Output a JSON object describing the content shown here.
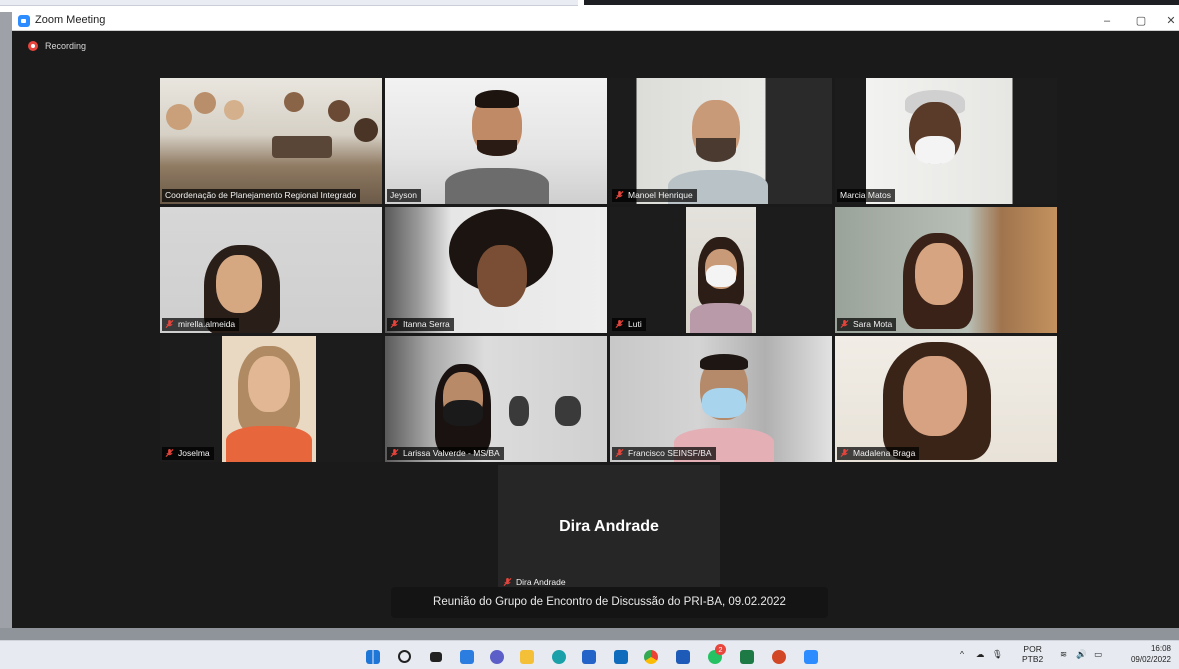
{
  "window": {
    "title": "Zoom Meeting",
    "minimize": "–",
    "maximize": "▢",
    "close": "✕"
  },
  "recording": {
    "label": "Recording"
  },
  "participants": [
    {
      "name": "Coordenação de Planejamento Regional Integrado",
      "muted": false
    },
    {
      "name": "Jeyson",
      "muted": false,
      "speaking": true
    },
    {
      "name": "Manoel Henrique",
      "muted": true
    },
    {
      "name": "Marcia Matos",
      "muted": false
    },
    {
      "name": "mirella.almeida",
      "muted": true
    },
    {
      "name": "Itanna Serra",
      "muted": true
    },
    {
      "name": "Luti",
      "muted": true
    },
    {
      "name": "Sara Mota",
      "muted": true
    },
    {
      "name": "Joselma",
      "muted": true
    },
    {
      "name": "Larissa Valverde - MS/BA",
      "muted": true
    },
    {
      "name": "Francisco SEINSF/BA",
      "muted": true
    },
    {
      "name": "Madalena Braga",
      "muted": true
    },
    {
      "name": "Dira Andrade",
      "muted": true,
      "video_off": true
    }
  ],
  "caption": "Reunião do Grupo de Encontro de Discussão do PRI-BA, 09.02.2022",
  "taskbar": {
    "icons": [
      "windows-start-icon",
      "search-icon",
      "task-view-icon",
      "widgets-icon",
      "chat-icon",
      "file-explorer-icon",
      "edge-icon",
      "store-icon",
      "outlook-icon",
      "chrome-icon",
      "word-icon",
      "whatsapp-icon",
      "excel-icon",
      "powerpoint-icon",
      "zoom-icon"
    ],
    "whatsapp_badge": "2",
    "language": "POR",
    "layout": "PTB2",
    "time": "16:08",
    "date": "09/02/2022"
  },
  "colors": {
    "active_speaker": "#d5e64a",
    "muted_icon": "#e8453c",
    "window_bg": "#1a1a1a"
  }
}
